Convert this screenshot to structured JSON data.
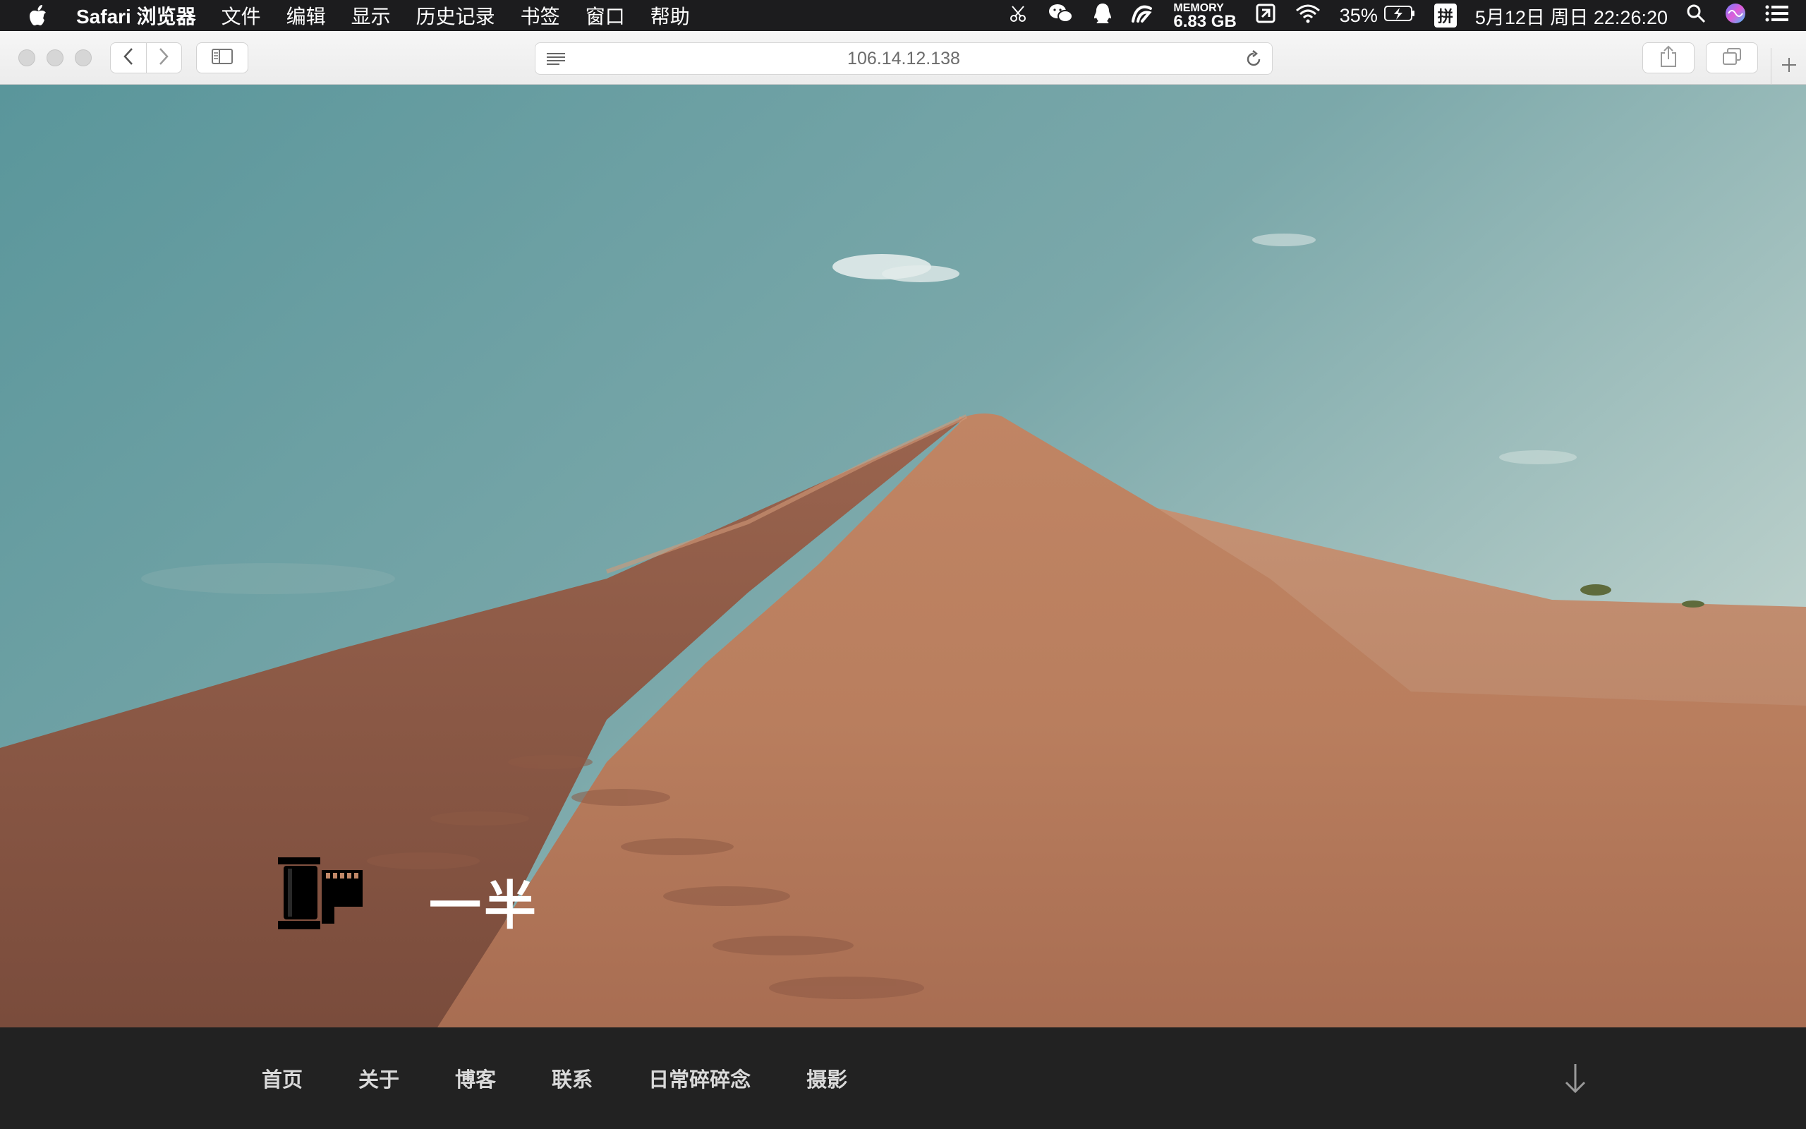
{
  "menubar": {
    "app_name": "Safari 浏览器",
    "items": [
      "文件",
      "编辑",
      "显示",
      "历史记录",
      "书签",
      "窗口",
      "帮助"
    ],
    "memory_label": "MEMORY",
    "memory_value": "6.83 GB",
    "battery": "35%",
    "input_method": "拼",
    "datetime": "5月12日 周日  22:26:20",
    "icons": [
      "apple-icon",
      "scissors-icon",
      "wechat-icon",
      "qq-icon",
      "activity-icon",
      "memory-icon",
      "share-screen-icon",
      "wifi-icon",
      "battery-charging-icon",
      "input-method-icon",
      "spotlight-icon",
      "siri-icon",
      "notification-center-icon"
    ]
  },
  "browser": {
    "url": "106.14.12.138",
    "icons": [
      "back-icon",
      "forward-icon",
      "sidebar-icon",
      "reader-icon",
      "reload-icon",
      "share-icon",
      "tabs-icon",
      "new-tab-icon"
    ]
  },
  "site": {
    "title": "一半",
    "logo": "film-roll-icon",
    "nav": [
      "首页",
      "关于",
      "博客",
      "联系",
      "日常碎碎念",
      "摄影"
    ],
    "scroll_icon": "arrow-down-icon"
  },
  "colors": {
    "sky_top": "#5f999e",
    "sky_right": "#b6cec9",
    "sand": "#b87c5d",
    "nav_bg": "#222222"
  }
}
